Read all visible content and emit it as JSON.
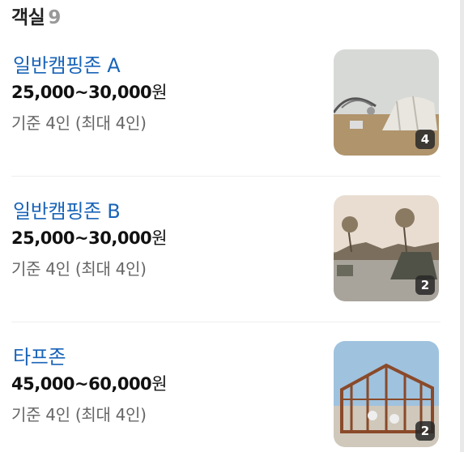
{
  "header": {
    "title": "객실",
    "count": "9"
  },
  "rooms": [
    {
      "name": "일반캠핑존 A",
      "price": "25,000~30,000",
      "currency": "원",
      "capacity": "기준 4인 (최대 4인)",
      "photo_count": "4"
    },
    {
      "name": "일반캠핑존 B",
      "price": "25,000~30,000",
      "currency": "원",
      "capacity": "기준 4인 (최대 4인)",
      "photo_count": "2"
    },
    {
      "name": "타프존",
      "price": "45,000~60,000",
      "currency": "원",
      "capacity": "기준 4인 (최대 4인)",
      "photo_count": "2"
    }
  ]
}
